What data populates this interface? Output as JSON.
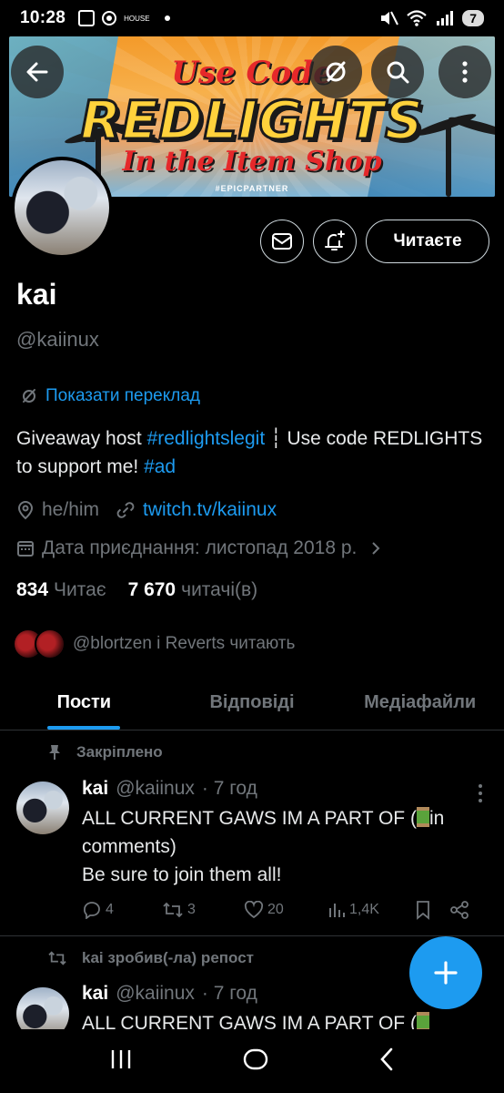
{
  "status_bar": {
    "time": "10:28",
    "house_label": "HOUSE",
    "battery": "7"
  },
  "banner": {
    "line1": "Use Code",
    "line2": "REDLIGHTS",
    "line3": "In the Item Shop",
    "tag": "#EPICPARTNER"
  },
  "profile": {
    "name": "kai",
    "handle": "@kaiinux",
    "translate_label": "Показати переклад",
    "bio_part1": "Giveaway host ",
    "bio_tag1": "#redlightslegit",
    "bio_part2": " ┆ Use code REDLIGHTS to support me! ",
    "bio_tag2": "#ad",
    "pronouns": "he/him",
    "website": "twitch.tv/kaiinux",
    "joined": "Дата приєднання: листопад 2018 р.",
    "following_count": "834",
    "following_label": "Читає",
    "followers_count": "7 670",
    "followers_label": "читачі(в)",
    "followed_by": "@blortzen і Reverts читають",
    "follow_button": "Читаєте"
  },
  "tabs": [
    {
      "label": "Пости",
      "active": true
    },
    {
      "label": "Відповіді",
      "active": false
    },
    {
      "label": "Медіафайли",
      "active": false
    }
  ],
  "tweet1": {
    "pinned_label": "Закріплено",
    "name": "kai",
    "handle": "@kaiinux",
    "time": "· 7 год",
    "text_part1": "ALL CURRENT GAWS IM A PART OF (",
    "text_part2": "in comments)",
    "text_line2": "Be sure to join them all!",
    "replies": "4",
    "reposts": "3",
    "likes": "20",
    "views": "1,4K"
  },
  "tweet2": {
    "repost_label": "kai зробив(-ла) репост",
    "name": "kai",
    "handle": "@kaiinux",
    "time": "· 7 год",
    "text_part1": "ALL CURRENT GAWS IM A PART OF ("
  },
  "icons": {
    "back": "back-arrow-icon",
    "translate": "translate-icon",
    "search": "search-icon",
    "more": "more-vertical-icon",
    "mail": "mail-icon",
    "bell": "bell-plus-icon"
  },
  "colors": {
    "accent": "#1d9bf0",
    "background": "#000000",
    "muted": "#71767b"
  }
}
